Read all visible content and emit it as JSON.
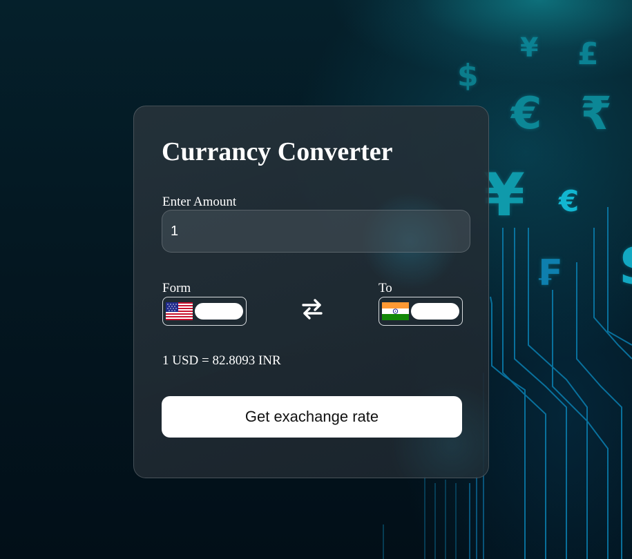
{
  "colors": {
    "accent": "#0e8a99",
    "card_bg": "#1e2a33",
    "text": "#ffffff",
    "button_bg": "#ffffff"
  },
  "background": {
    "symbols": [
      "$",
      "¥",
      "£",
      "€",
      "₹",
      "¥",
      "€",
      "₣",
      "$"
    ]
  },
  "converter": {
    "title": "Currancy Converter",
    "amount_label": "Enter Amount",
    "amount_value": "1",
    "from_label": "Form",
    "to_label": "To",
    "from_flag": "us-flag",
    "to_flag": "india-flag",
    "swap_icon": "swap-arrows-icon",
    "rate_text": "1 USD = 82.8093 INR",
    "button_label": "Get exachange rate"
  }
}
